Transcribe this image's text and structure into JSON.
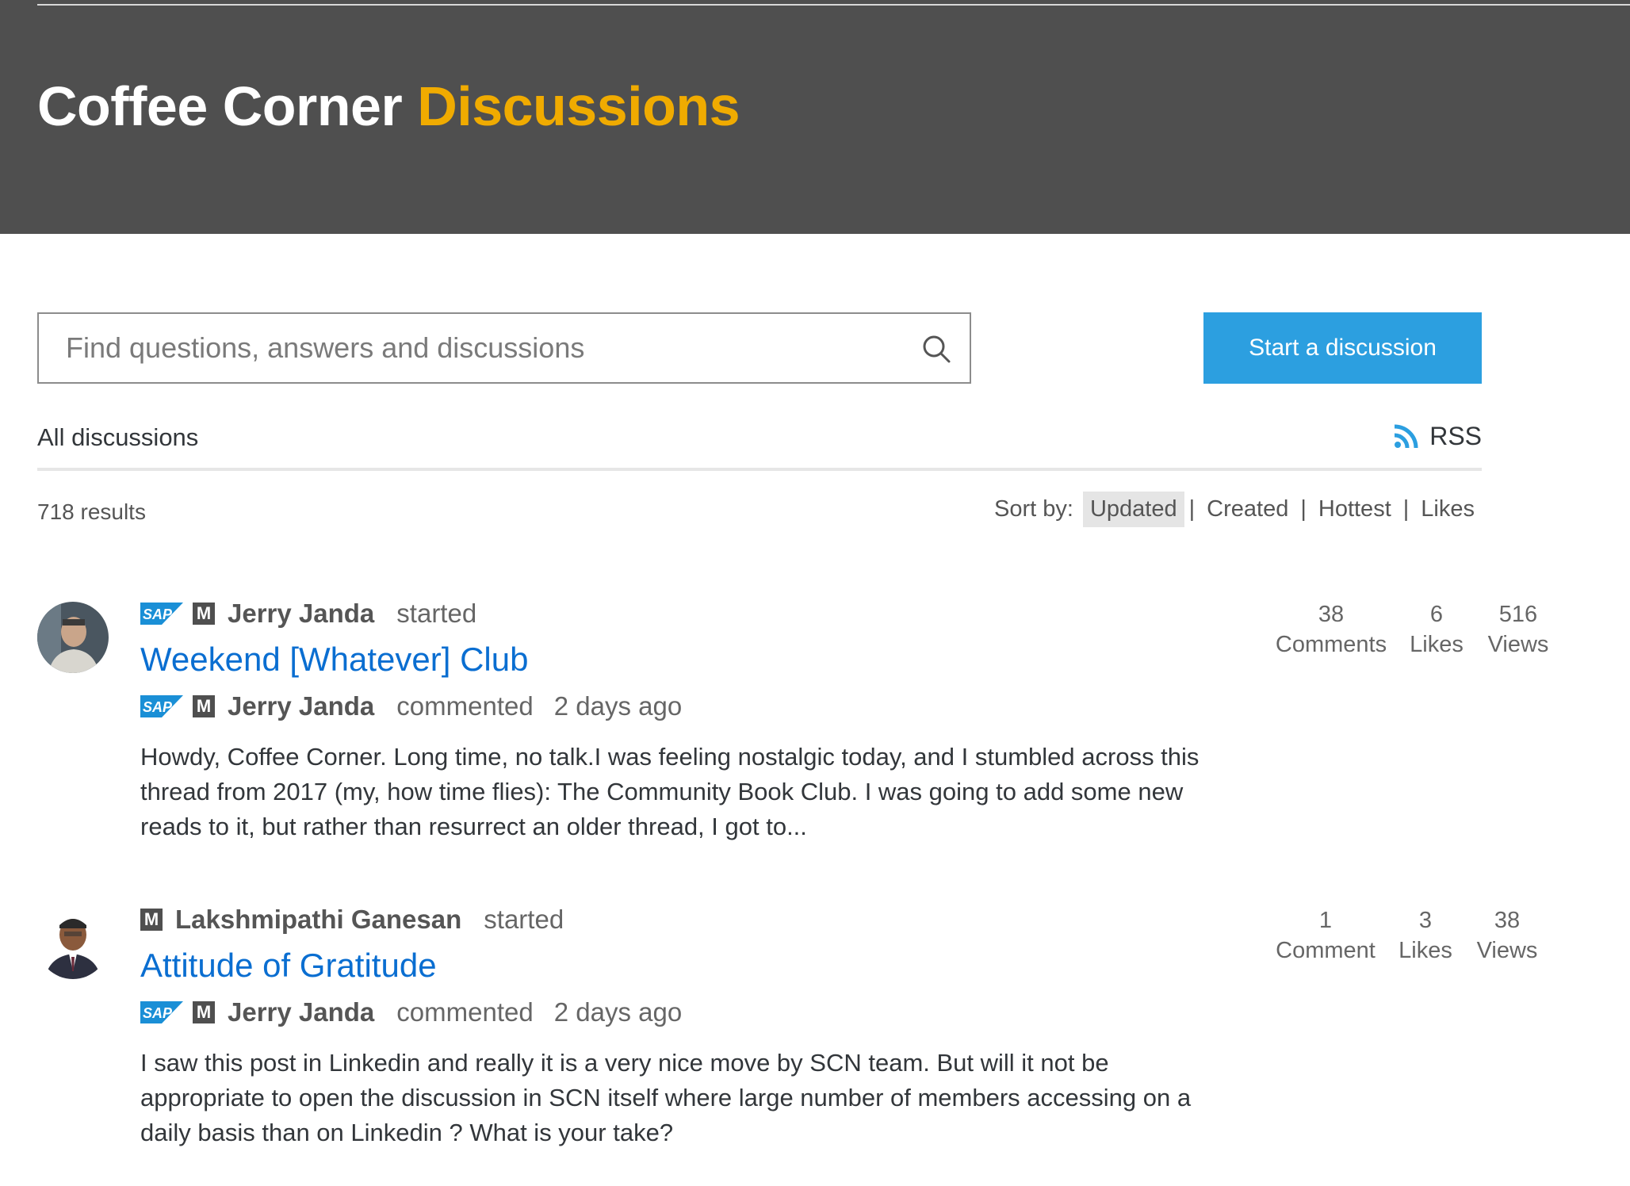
{
  "banner": {
    "title_white": "Coffee Corner",
    "title_accent": "Discussions"
  },
  "search": {
    "placeholder": "Find questions, answers and discussions"
  },
  "actions": {
    "start_label": "Start a discussion"
  },
  "filter": {
    "all_label": "All discussions",
    "rss_label": "RSS"
  },
  "results": {
    "count_label": "718 results"
  },
  "sort": {
    "label": "Sort by:",
    "options": [
      "Updated",
      "Created",
      "Hottest",
      "Likes"
    ],
    "active": "Updated",
    "separator": "|"
  },
  "discussions": [
    {
      "starter": {
        "name": "Jerry Janda",
        "badges": [
          "SAP",
          "M"
        ],
        "verb": "started"
      },
      "title": "Weekend [Whatever] Club",
      "last": {
        "name": "Jerry Janda",
        "badges": [
          "SAP",
          "M"
        ],
        "verb": "commented",
        "time": "2 days ago"
      },
      "excerpt": "Howdy, Coffee Corner. Long time, no talk.I was feeling nostalgic today, and I stumbled across this thread from 2017 (my, how time flies): The Community Book Club. I was going to add some new reads to it, but rather than resurrect an older thread, I got to...",
      "stats": {
        "comments": "38",
        "comments_label": "Comments",
        "likes": "6",
        "likes_label": "Likes",
        "views": "516",
        "views_label": "Views"
      }
    },
    {
      "starter": {
        "name": "Lakshmipathi Ganesan",
        "badges": [
          "M"
        ],
        "verb": "started"
      },
      "title": "Attitude of Gratitude",
      "last": {
        "name": "Jerry Janda",
        "badges": [
          "SAP",
          "M"
        ],
        "verb": "commented",
        "time": "2 days ago"
      },
      "excerpt": "I saw this post in Linkedin and really it is a very nice move by SCN team. But will it not be appropriate to open the discussion in SCN itself where large number of members accessing on a daily basis than on Linkedin ? What is your take?",
      "stats": {
        "comments": "1",
        "comments_label": "Comment",
        "likes": "3",
        "likes_label": "Likes",
        "views": "38",
        "views_label": "Views"
      }
    }
  ],
  "badge_text": {
    "sap": "SAP",
    "moderator": "M"
  },
  "colors": {
    "banner": "#4f4f4f",
    "accent": "#f0ab00",
    "link": "#0a6ed1",
    "button": "#2c9fe0",
    "rss": "#2c9fe0"
  },
  "icons": {
    "search": "search-icon",
    "rss": "rss-icon"
  }
}
